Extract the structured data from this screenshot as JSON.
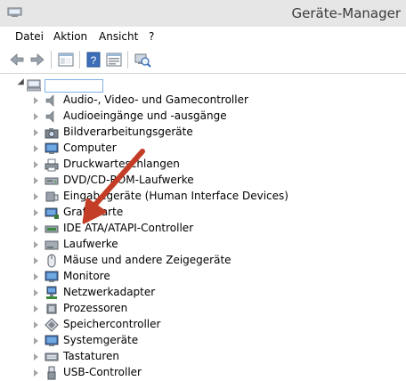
{
  "window": {
    "title": "Geräte-Manager"
  },
  "menu": [
    {
      "label": "Datei"
    },
    {
      "label": "Aktion"
    },
    {
      "label": "Ansicht"
    },
    {
      "label": "?"
    }
  ],
  "tree": {
    "root_name": "",
    "categories": [
      {
        "label": "Audio-, Video- und Gamecontroller",
        "icon": "speaker-icon"
      },
      {
        "label": "Audioeingänge und -ausgänge",
        "icon": "speaker-icon"
      },
      {
        "label": "Bildverarbeitungsgeräte",
        "icon": "camera-icon"
      },
      {
        "label": "Computer",
        "icon": "monitor-icon"
      },
      {
        "label": "Druckwarteschlangen",
        "icon": "printer-icon"
      },
      {
        "label": "DVD/CD-ROM-Laufwerke",
        "icon": "disc-drive-icon"
      },
      {
        "label": "Eingabegeräte (Human Interface Devices)",
        "icon": "hid-icon"
      },
      {
        "label": "Grafikkarte",
        "icon": "display-adapter-icon"
      },
      {
        "label": "IDE ATA/ATAPI-Controller",
        "icon": "ide-controller-icon"
      },
      {
        "label": "Laufwerke",
        "icon": "drive-icon"
      },
      {
        "label": "Mäuse und andere Zeigegeräte",
        "icon": "mouse-icon"
      },
      {
        "label": "Monitore",
        "icon": "monitor-icon"
      },
      {
        "label": "Netzwerkadapter",
        "icon": "network-adapter-icon"
      },
      {
        "label": "Prozessoren",
        "icon": "processor-icon"
      },
      {
        "label": "Speichercontroller",
        "icon": "storage-controller-icon"
      },
      {
        "label": "Systemgeräte",
        "icon": "system-device-icon"
      },
      {
        "label": "Tastaturen",
        "icon": "keyboard-icon"
      },
      {
        "label": "USB-Controller",
        "icon": "usb-icon"
      }
    ]
  },
  "colors": {
    "arrow": "#c43e27",
    "titlebar": "#e6e6e6",
    "selection_border": "#7eb4ea"
  }
}
